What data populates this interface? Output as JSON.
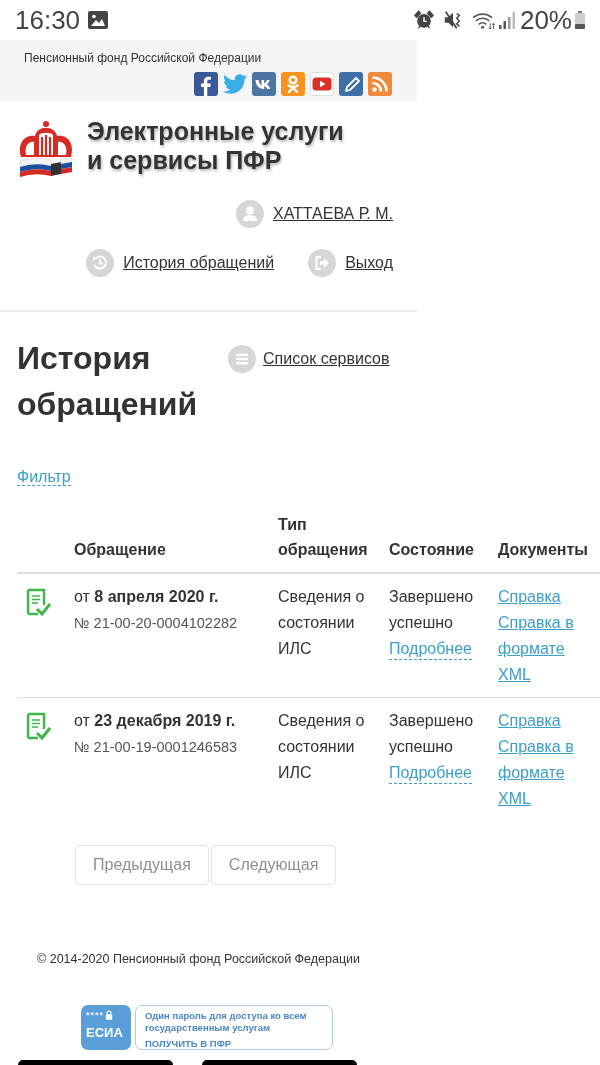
{
  "status_bar": {
    "time": "16:30",
    "battery": "20%"
  },
  "top_bar": {
    "org_name": "Пенсионный фонд Российской Федерации"
  },
  "site": {
    "title_lines": [
      "Электронные услуги",
      "и сервисы ПФР"
    ],
    "user_name": "ХАТТАЕВА Р. М.",
    "nav_links": [
      {
        "kind": "history",
        "label": "История обращений"
      },
      {
        "kind": "logout",
        "label": "Выход"
      }
    ]
  },
  "page": {
    "title": "История обращений",
    "services_link": "Список сервисов",
    "filter_link": "Фильтр"
  },
  "table": {
    "columns": [
      "Обращение",
      "Тип обращения",
      "Состояние",
      "Документы"
    ],
    "rows": [
      {
        "request": "от **8 апреля 2020 г.**",
        "number": "№ 21-00-20-0004102282",
        "type": "Сведения о состоянии ИЛС",
        "status": "Завершено успешно",
        "details_link": "Подробнее",
        "documents": [
          "Справка",
          "Справка в формате XML"
        ]
      },
      {
        "request": "от **23 декабря 2019 г.**",
        "number": "№ 21-00-19-0001246583",
        "type": "Сведения о состоянии ИЛС",
        "status": "Завершено успешно",
        "details_link": "Подробнее",
        "documents": [
          "Справка",
          "Справка в формате XML"
        ]
      }
    ]
  },
  "pagination": [
    {
      "label": "Предыдущая",
      "disabled": true
    },
    {
      "label": "Следующая",
      "disabled": true
    }
  ],
  "footer": {
    "copyright": "© 2014-2020 Пенсионный фонд Российской Федерации",
    "esia": {
      "mask": "****",
      "label": "ЕСИА",
      "text_lines": [
        "Один пароль для доступа ко всем",
        "государственным услугам"
      ],
      "link": "ПОЛУЧИТЬ В ПФР"
    }
  }
}
